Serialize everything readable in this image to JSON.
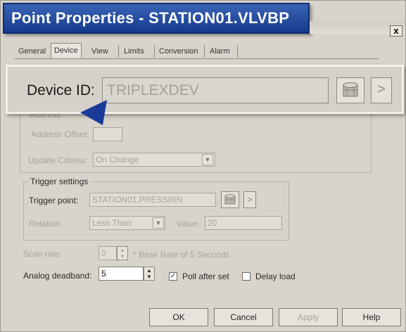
{
  "window": {
    "title": "Point Properties - STATION01.VLVBP",
    "close_label": "x"
  },
  "tabs": [
    "General",
    "Device",
    "View",
    "Limits",
    "Conversion",
    "Alarm"
  ],
  "device": {
    "label": "Device ID:",
    "value": "TRIPLEXDEV",
    "arrow_label": ">"
  },
  "address": {
    "group_legend": "Address",
    "offset_label": "Address Offset:",
    "update_label": "Update Criteria:",
    "update_value": "On Change"
  },
  "trigger": {
    "legend": "Trigger settings",
    "point_label": "Trigger point:",
    "point_value": "STATION01.PRESSRIN",
    "arrow_label": ">",
    "relation_label": "Relation:",
    "relation_value": "Less Than",
    "value_label": "Value:",
    "value_value": "20"
  },
  "scan": {
    "label": "Scan rate:",
    "value": "0",
    "note": "* Base Rate of 5 Seconds"
  },
  "deadband": {
    "label": "Analog deadband:",
    "value": "5"
  },
  "options": {
    "poll_after_set": "Poll after set",
    "poll_checked_mark": "✓",
    "delay_load": "Delay load"
  },
  "buttons": {
    "ok": "OK",
    "cancel": "Cancel",
    "apply": "Apply",
    "help": "Help"
  },
  "colors": {
    "title_bar": "#1f4a9e",
    "pointer": "#1a3a9a"
  }
}
